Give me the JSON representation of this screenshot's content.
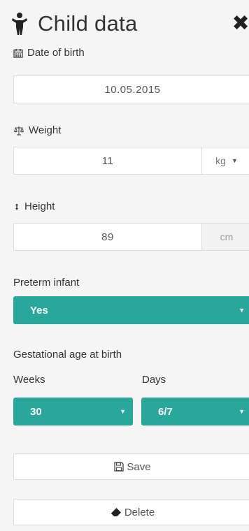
{
  "header": {
    "title": "Child data",
    "close_symbol": "✖"
  },
  "dob": {
    "label": "Date of birth",
    "value": "10.05.2015"
  },
  "weight": {
    "label": "Weight",
    "value": "11",
    "unit": "kg"
  },
  "height": {
    "label": "Height",
    "value": "89",
    "unit": "cm"
  },
  "preterm": {
    "label": "Preterm infant",
    "selected": "Yes"
  },
  "gestational": {
    "label": "Gestational age at birth",
    "weeks_label": "Weeks",
    "days_label": "Days",
    "weeks_value": "30",
    "days_value": "6/7"
  },
  "actions": {
    "save_label": "Save",
    "delete_label": "Delete"
  },
  "colors": {
    "accent": "#2aa79b",
    "background": "#f5f5f5"
  }
}
